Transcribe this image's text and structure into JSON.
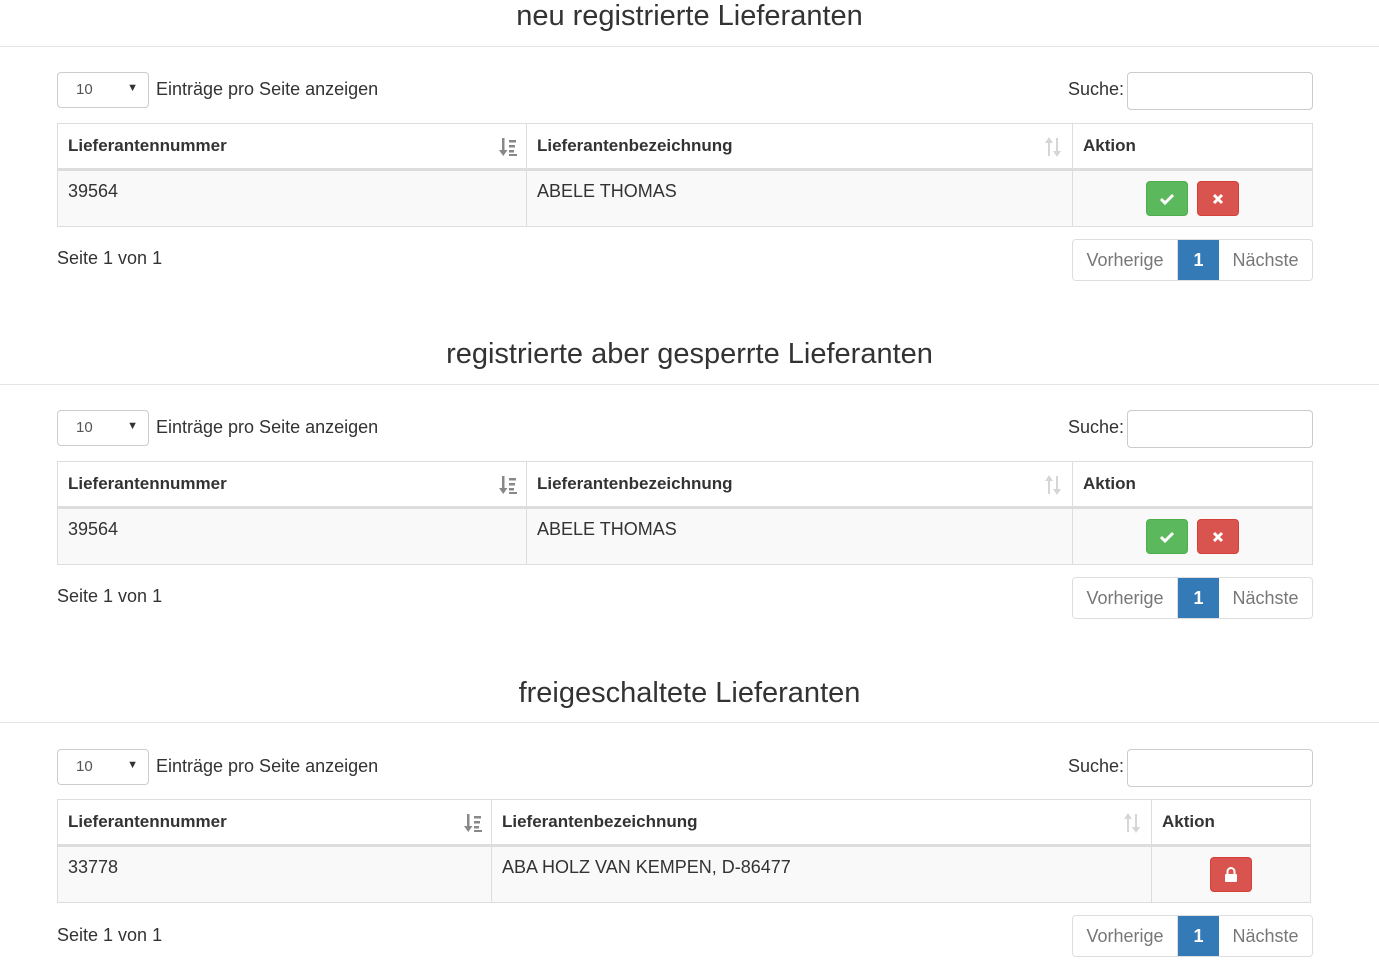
{
  "sections": [
    {
      "title": "neu registrierte Lieferanten",
      "length": {
        "value": "10",
        "label": "Einträge pro Seite anzeigen"
      },
      "search": {
        "label": "Suche:",
        "value": ""
      },
      "columns": [
        "Lieferantennummer",
        "Lieferantenbezeichnung",
        "Aktion"
      ],
      "rows": [
        {
          "number": "39564",
          "name": "ABELE THOMAS"
        }
      ],
      "info": "Seite 1 von 1",
      "pager": {
        "prev": "Vorherige",
        "current": "1",
        "next": "Nächste"
      }
    },
    {
      "title": "registrierte aber gesperrte Lieferanten",
      "length": {
        "value": "10",
        "label": "Einträge pro Seite anzeigen"
      },
      "search": {
        "label": "Suche:",
        "value": ""
      },
      "columns": [
        "Lieferantennummer",
        "Lieferantenbezeichnung",
        "Aktion"
      ],
      "rows": [
        {
          "number": "39564",
          "name": "ABELE THOMAS"
        }
      ],
      "info": "Seite 1 von 1",
      "pager": {
        "prev": "Vorherige",
        "current": "1",
        "next": "Nächste"
      }
    },
    {
      "title": "freigeschaltete Lieferanten",
      "length": {
        "value": "10",
        "label": "Einträge pro Seite anzeigen"
      },
      "search": {
        "label": "Suche:",
        "value": ""
      },
      "columns": [
        "Lieferantennummer",
        "Lieferantenbezeichnung",
        "Aktion"
      ],
      "rows": [
        {
          "number": "33778",
          "name": "ABA HOLZ VAN KEMPEN, D-86477"
        }
      ],
      "info": "Seite 1 von 1",
      "pager": {
        "prev": "Vorherige",
        "current": "1",
        "next": "Nächste"
      }
    }
  ],
  "colors": {
    "approve": "#5cb85c",
    "reject": "#d9534f",
    "active_page": "#337ab7"
  },
  "icons": {
    "sort_active": "sort-amount-icon",
    "sort_inactive": "sort-both-icon",
    "approve": "check-icon",
    "reject": "close-icon",
    "locked": "lock-icon"
  }
}
